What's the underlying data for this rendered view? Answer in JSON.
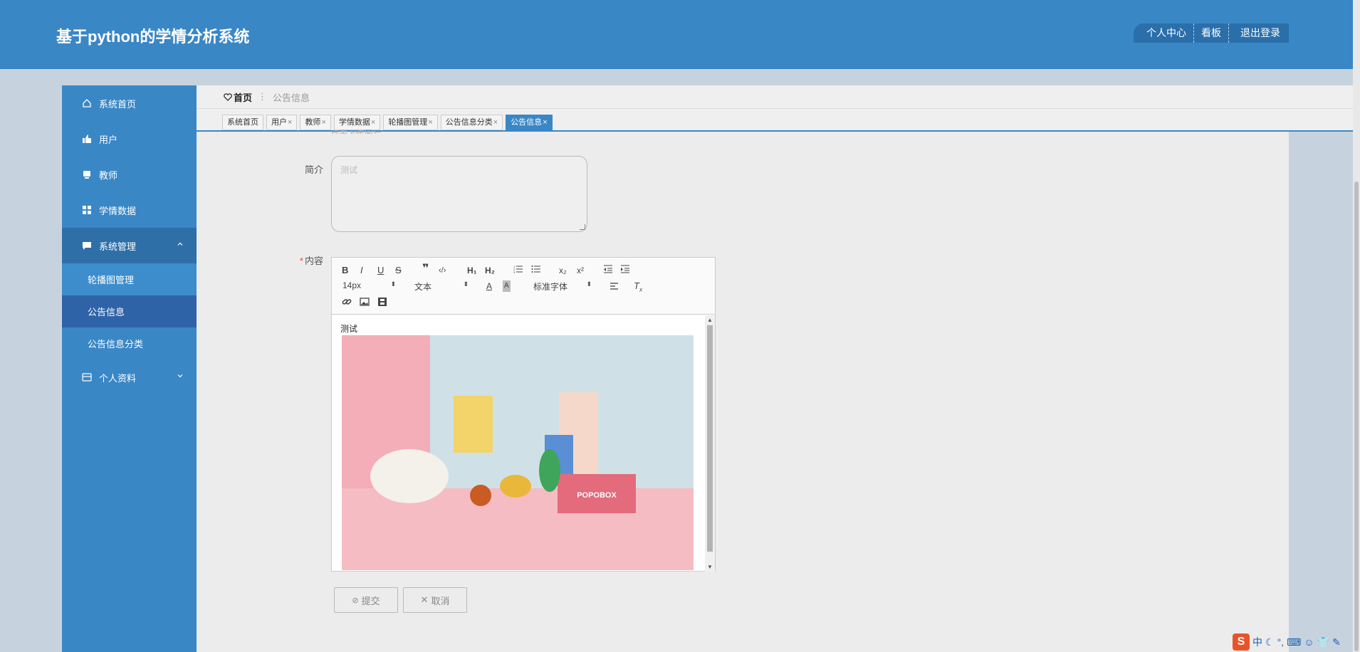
{
  "header": {
    "title": "基于python的学情分析系统",
    "nav": [
      "个人中心",
      "看板",
      "退出登录"
    ]
  },
  "sidebar": {
    "items": [
      {
        "label": "系统首页",
        "icon": "home-icon"
      },
      {
        "label": "用户",
        "icon": "thumb-icon"
      },
      {
        "label": "教师",
        "icon": "tv-icon"
      },
      {
        "label": "学情数据",
        "icon": "grid-icon"
      },
      {
        "label": "系统管理",
        "icon": "chat-icon",
        "expanded": true
      },
      {
        "label": "个人资料",
        "icon": "card-icon",
        "expanded": false
      }
    ],
    "sub_items": [
      "轮播图管理",
      "公告信息",
      "公告信息分类"
    ]
  },
  "breadcrumb": {
    "home": "首页",
    "current": "公告信息"
  },
  "tabs": [
    "系统首页",
    "用户",
    "教师",
    "学情数据",
    "轮播图管理",
    "公告信息分类",
    "公告信息"
  ],
  "tab_close": "×",
  "form": {
    "upload_hint": "点击上传图片",
    "intro_label": "简介",
    "intro_placeholder": "测试",
    "content_label": "内容",
    "required_mark": "*",
    "content_text": "测试",
    "submit": "提交",
    "cancel": "取消"
  },
  "editor_toolbar": {
    "font_size": "14px",
    "format": "文本",
    "font_family": "标准字体"
  },
  "photo": {
    "box_label": "POPOBOX"
  },
  "tray": {
    "ime": "中"
  },
  "colors": {
    "primary": "#3a87c6",
    "sidebar_selected": "#2f63a7",
    "background": "#ececec"
  }
}
